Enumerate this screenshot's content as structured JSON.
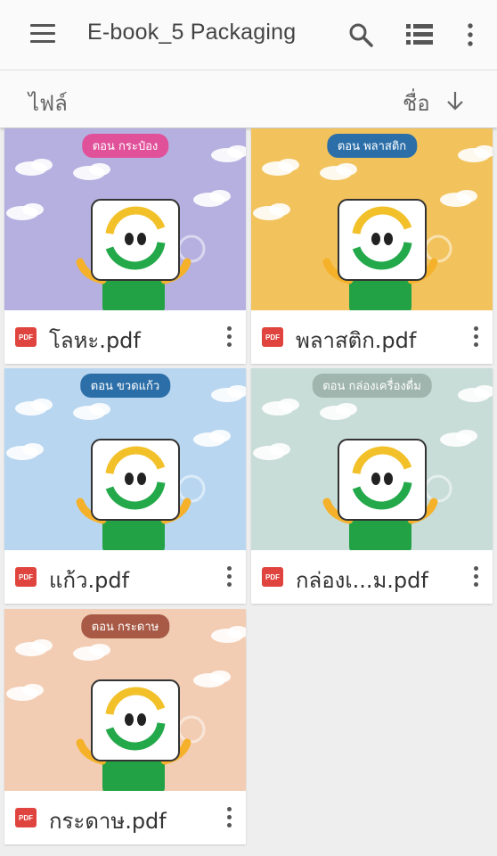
{
  "appbar": {
    "title": "E-book_5 Packaging",
    "icons": [
      "menu-icon",
      "search-icon",
      "list-view-icon",
      "more-vert-icon"
    ]
  },
  "sortbar": {
    "files_label": "ไฟล์",
    "sort_label": "ชื่อ",
    "sort_direction_icon": "arrow-down-icon"
  },
  "colors": {
    "accent_pdf": "#e0443e",
    "appbar_bg": "#fafafa",
    "page_bg": "#eeeeee"
  },
  "files": [
    {
      "name": "โลหะ.pdf",
      "badge": "ตอน กระป๋อง",
      "badge_color": "#e0519a",
      "bg": "#b5b0e0"
    },
    {
      "name": "พลาสติก.pdf",
      "badge": "ตอน พลาสติก",
      "badge_color": "#2c6fa8",
      "bg": "#f2c35c"
    },
    {
      "name": "แก้ว.pdf",
      "badge": "ตอน ขวดแก้ว",
      "badge_color": "#2c6fa8",
      "bg": "#b9d6f0"
    },
    {
      "name": "กล่องเ...ม.pdf",
      "badge": "ตอน กล่องเครื่องดื่ม",
      "badge_color": "#9fb5ad",
      "bg": "#c9ddd8"
    },
    {
      "name": "กระดาษ.pdf",
      "badge": "ตอน กระดาษ",
      "badge_color": "#a85a46",
      "bg": "#f2cdb3"
    }
  ]
}
